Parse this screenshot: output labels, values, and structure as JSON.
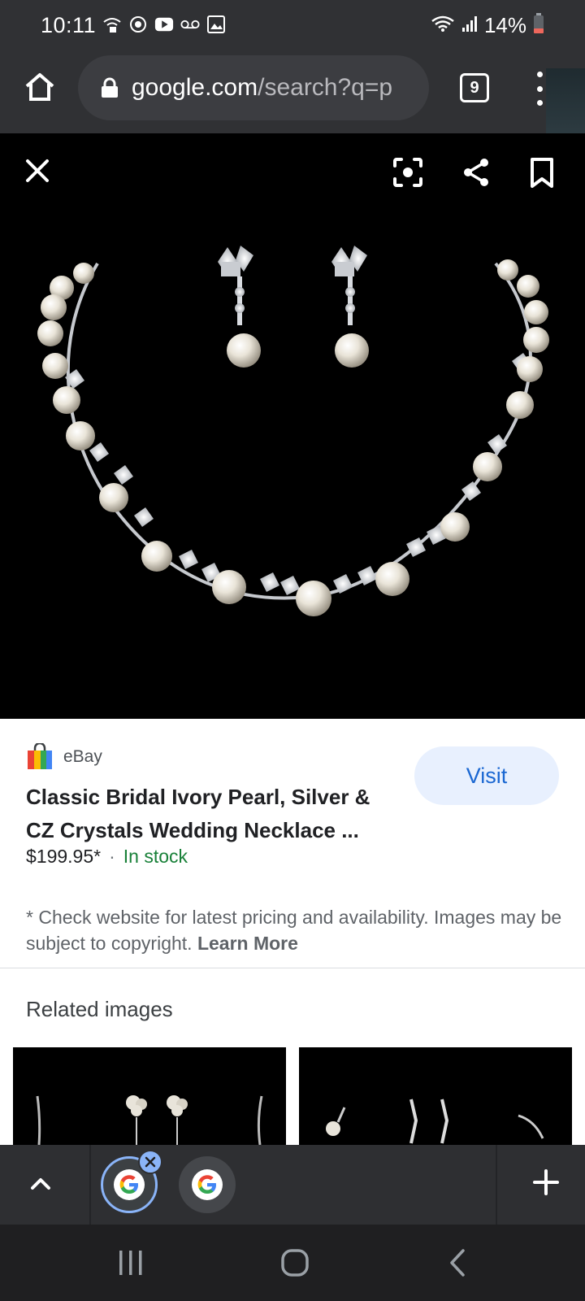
{
  "status_bar": {
    "time": "10:11",
    "battery": "14%"
  },
  "browser": {
    "url_domain": "google.com",
    "url_path": "/search?q=p",
    "tab_count": "9"
  },
  "viewer": {
    "icons": [
      "close-icon",
      "lens-icon",
      "share-icon",
      "save-icon"
    ]
  },
  "result": {
    "source": "eBay",
    "visit_label": "Visit",
    "title": "Classic Bridal Ivory Pearl, Silver & CZ Crystals Wedding Necklace ...",
    "price": "$199.95*",
    "separator": "·",
    "availability": "In stock",
    "disclaimer": "* Check website for latest pricing and availability. Images may be subject to copyright.",
    "learn_more": "Learn More"
  },
  "related": {
    "title": "Related images"
  },
  "colors": {
    "accent": "#1a67d2",
    "stock_green": "#188038",
    "visit_bg": "#e8f0fe",
    "chrome_dark": "#303134"
  }
}
